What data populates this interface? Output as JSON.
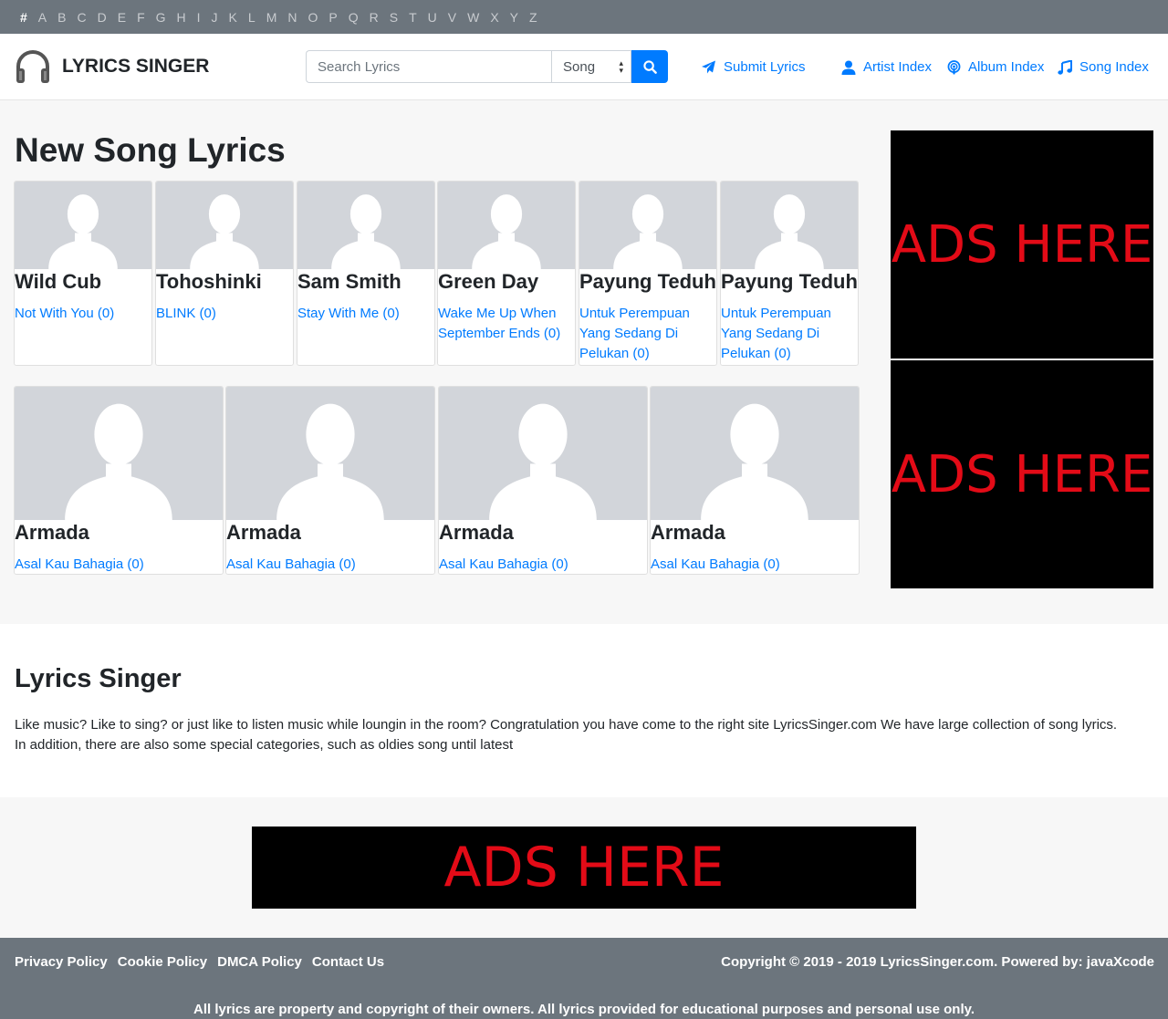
{
  "alphabet": [
    "#",
    "A",
    "B",
    "C",
    "D",
    "E",
    "F",
    "G",
    "H",
    "I",
    "J",
    "K",
    "L",
    "M",
    "N",
    "O",
    "P",
    "Q",
    "R",
    "S",
    "T",
    "U",
    "V",
    "W",
    "X",
    "Y",
    "Z"
  ],
  "alphabet_active": "#",
  "header": {
    "brand": "LYRICS SINGER",
    "search_placeholder": "Search Lyrics",
    "search_type": "Song",
    "nav": {
      "submit": "Submit Lyrics",
      "artist_index": "Artist Index",
      "album_index": "Album Index",
      "song_index": "Song Index"
    }
  },
  "main": {
    "title": "New Song Lyrics",
    "row1": [
      {
        "artist": "Wild Cub",
        "song": "Not With You (0)"
      },
      {
        "artist": "Tohoshinki",
        "song": "BLINK (0)"
      },
      {
        "artist": "Sam Smith",
        "song": "Stay With Me (0)"
      },
      {
        "artist": "Green Day",
        "song": "Wake Me Up When September Ends (0)"
      },
      {
        "artist": "Payung Teduh",
        "song": "Untuk Perempuan Yang Sedang Di Pelukan (0)"
      },
      {
        "artist": "Payung Teduh",
        "song": "Untuk Perempuan Yang Sedang Di Pelukan (0)"
      }
    ],
    "row2": [
      {
        "artist": "Armada",
        "song": "Asal Kau Bahagia (0)"
      },
      {
        "artist": "Armada",
        "song": "Asal Kau Bahagia (0)"
      },
      {
        "artist": "Armada",
        "song": "Asal Kau Bahagia (0)"
      },
      {
        "artist": "Armada",
        "song": "Asal Kau Bahagia (0)"
      }
    ],
    "ads": [
      "ADS HERE",
      "ADS HERE"
    ]
  },
  "about": {
    "title": "Lyrics Singer",
    "line1": "Like music? Like to sing? or just like to listen music while loungin in the room? Congratulation you have come to the right site LyricsSinger.com We have large collection of song lyrics.",
    "line2": "In addition, there are also some special categories, such as oldies song until latest"
  },
  "bottom_ad": "ADS HERE",
  "footer": {
    "links": [
      "Privacy Policy",
      "Cookie Policy",
      "DMCA Policy",
      "Contact Us"
    ],
    "copyright": "Copyright © 2019 - 2019 LyricsSinger.com. Powered by: javaXcode",
    "disclaimer": "All lyrics are property and copyright of their owners. All lyrics provided for educational purposes and personal use only."
  },
  "colors": {
    "link": "#007bff",
    "bar": "#6c757d",
    "ad_text": "#e30b17"
  }
}
